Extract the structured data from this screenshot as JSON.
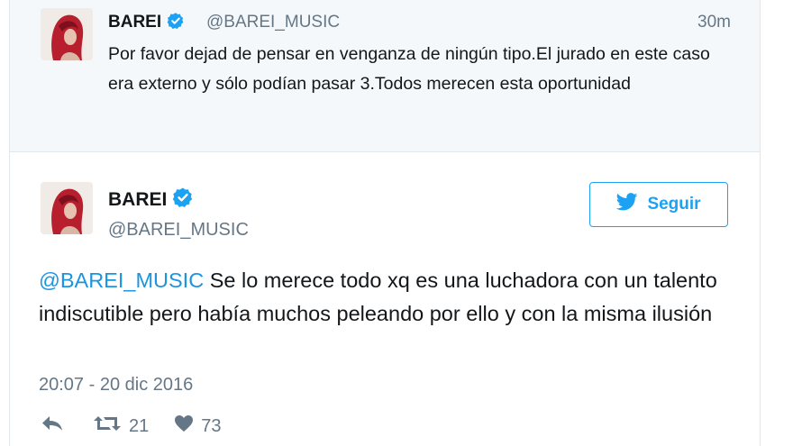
{
  "parent_tweet": {
    "name": "BAREI",
    "handle": "@BAREI_MUSIC",
    "time": "30m",
    "text": "Por favor dejad de pensar en venganza de ningún tipo.El jurado en este caso era externo y sólo podían pasar 3.Todos merecen esta oportunidad"
  },
  "main_tweet": {
    "name": "BAREI",
    "handle": "@BAREI_MUSIC",
    "follow_label": "Seguir",
    "mention": "@BAREI_MUSIC",
    "text": " Se lo merece todo xq es una luchadora con un talento indiscutible pero había muchos peleando por ello y con la misma ilusión",
    "date": "20:07 - 20 dic 2016",
    "retweets": "21",
    "likes": "73"
  },
  "colors": {
    "accent": "#1da1f2",
    "mention": "#1b95e0",
    "secondary_text": "#657786",
    "parent_bg": "#f5f8fa"
  },
  "icons": [
    "verified-badge-icon",
    "twitter-bird-icon",
    "reply-icon",
    "retweet-icon",
    "heart-icon"
  ]
}
